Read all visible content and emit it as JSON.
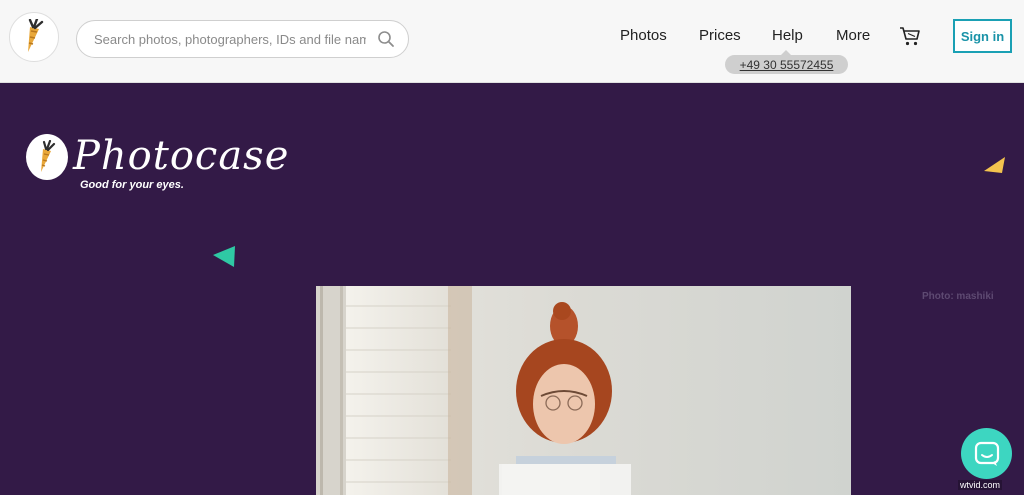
{
  "search": {
    "placeholder": "Search photos, photographers, IDs and file names"
  },
  "nav": {
    "photos": "Photos",
    "prices": "Prices",
    "help": "Help",
    "more": "More"
  },
  "signin_label": "Sign in",
  "phone": "+49 30 55572455",
  "brand": {
    "name": "Photocase",
    "tagline": "Good for your eyes."
  },
  "photo_credit": "Photo: mashiki",
  "watermark": "wtvid.com",
  "colors": {
    "hero_bg": "#331a47",
    "accent_teal": "#1aa0b4",
    "chat": "#3dd6c1",
    "tri_teal": "#2fc9a4",
    "tri_yellow": "#f3c34e"
  }
}
